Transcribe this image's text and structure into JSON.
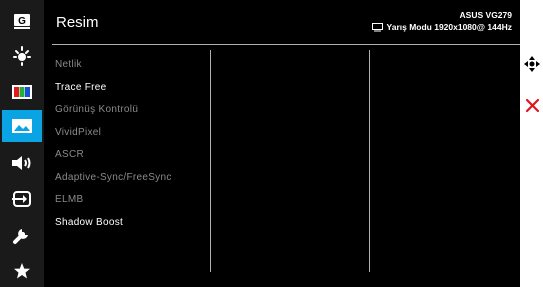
{
  "sidebar": {
    "items": [
      {
        "icon": "gameplus-g-icon"
      },
      {
        "icon": "brightness-icon"
      },
      {
        "icon": "color-icon"
      },
      {
        "icon": "image-icon",
        "active": true
      },
      {
        "icon": "sound-icon"
      },
      {
        "icon": "input-select-icon"
      },
      {
        "icon": "wrench-icon"
      },
      {
        "icon": "star-icon"
      }
    ],
    "gameplus_letter": "G",
    "active_color": "#0aa3e4"
  },
  "header": {
    "title": "Resim",
    "model": "ASUS VG279",
    "status": "Yarış Modu 1920x1080@ 144Hz"
  },
  "menu": {
    "items": [
      {
        "label": "Netlik",
        "enabled": false
      },
      {
        "label": "Trace Free",
        "enabled": true
      },
      {
        "label": "Görünüş Kontrolü",
        "enabled": false
      },
      {
        "label": "VividPixel",
        "enabled": false
      },
      {
        "label": "ASCR",
        "enabled": false
      },
      {
        "label": "Adaptive-Sync/FreeSync",
        "enabled": false
      },
      {
        "label": "ELMB",
        "enabled": false
      },
      {
        "label": "Shadow Boost",
        "enabled": true
      }
    ]
  },
  "side_controls": {
    "navigate_icon": "five-way-navigation-icon",
    "close_icon": "close-x-icon",
    "close_color": "#e0141e"
  }
}
